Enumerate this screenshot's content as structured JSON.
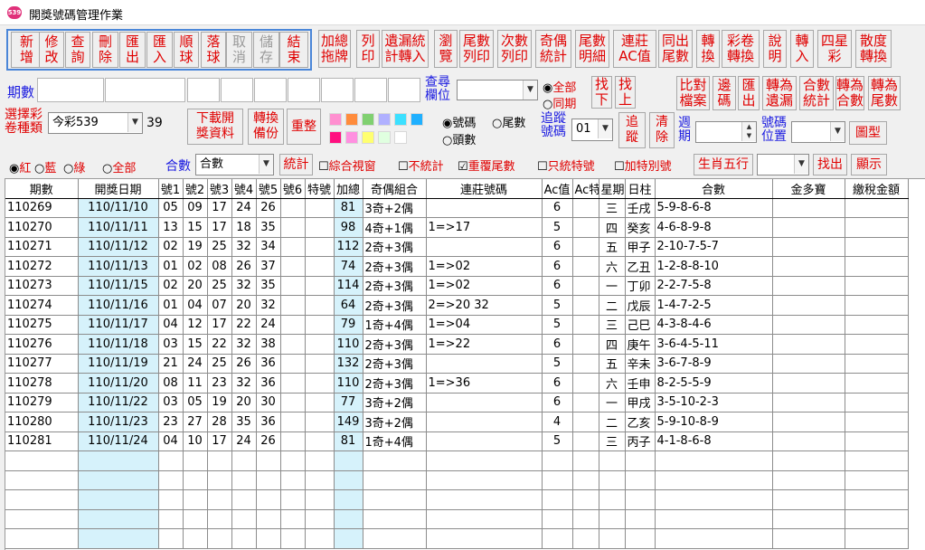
{
  "window": {
    "title": "開獎號碼管理作業",
    "icon_text": "539"
  },
  "toolbar1": [
    {
      "label": "新\n增",
      "disabled": false
    },
    {
      "label": "修\n改",
      "disabled": false
    },
    {
      "label": "查\n詢",
      "disabled": false
    },
    {
      "label": "刪\n除",
      "disabled": false
    },
    {
      "label": "匯\n出",
      "disabled": false
    },
    {
      "label": "匯\n入",
      "disabled": false
    },
    {
      "label": "順\n球",
      "disabled": false
    },
    {
      "label": "落\n球",
      "disabled": false
    },
    {
      "label": "取\n消",
      "disabled": true
    },
    {
      "label": "儲\n存",
      "disabled": true
    },
    {
      "label": "結\n束",
      "disabled": false
    }
  ],
  "toolbar2": [
    "加總\n拖牌",
    "列\n印",
    "遺漏統\n計轉入",
    "瀏\n覽",
    "尾數\n列印",
    "次數\n列印",
    "奇偶\n統計",
    "尾數\n明細",
    "連莊\nAC值",
    "同出\n尾數",
    "轉\n換",
    "彩卷\n轉換",
    "說\n明",
    "轉\n入",
    "四星\n彩",
    "散度\n轉換"
  ],
  "row2": {
    "period_label": "期數",
    "query_label": "查尋\n欄位",
    "radio_all": "全部",
    "radio_same": "同期",
    "btn_find_down": "找\n下",
    "btn_find_up": "找\n上",
    "right_buttons": [
      "比對\n檔案",
      "邊\n碼",
      "匯\n出",
      "轉為\n遺漏",
      "合數\n統計",
      "轉為\n合數",
      "轉為\n尾數"
    ]
  },
  "row3": {
    "lottery_type_label": "選擇彩\n卷種類",
    "lottery_type_value": "今彩539",
    "lottery_count": "39",
    "btn_download": "下載開\n獎資料",
    "btn_backup": "轉換\n備份",
    "btn_reorg": "重整",
    "swatch_colors": [
      "#ff8fd0",
      "#ff8c3c",
      "#80d070",
      "#b0b0ff",
      "#3ce0ff",
      "#20b0ff",
      "#ff1080",
      "#ff90e0",
      "#ffff70",
      "#e0ffe0",
      "#ffffff"
    ],
    "radio_number": "號碼",
    "radio_tail": "尾數",
    "radio_head": "頭數",
    "track_label": "追蹤\n號碼",
    "track_value": "01",
    "btn_track": "追\n蹤",
    "btn_clear": "清\n除",
    "week_label": "週\n期",
    "pos_label": "號碼\n位置",
    "btn_chart": "圖型"
  },
  "row4": {
    "radio_red": "紅",
    "radio_blue": "藍",
    "radio_green": "綠",
    "radio_all": "全部",
    "sum_label": "合數",
    "sum_value": "合數",
    "btn_stat": "統計",
    "chk_combined": "綜合視窗",
    "chk_nostat": "不統計",
    "chk_repeat": "重覆尾數",
    "chk_only_special": "只統特號",
    "chk_add_special": "加特別號",
    "btn_zodiac": "生肖五行",
    "btn_find": "找出",
    "btn_show": "顯示"
  },
  "grid": {
    "columns": [
      "期數",
      "開獎日期",
      "號1",
      "號2",
      "號3",
      "號4",
      "號5",
      "號6",
      "特號",
      "加總",
      "奇偶組合",
      "連莊號碼",
      "Ac值",
      "Ac特",
      "星期",
      "日柱",
      "合數",
      "金多寶",
      "繳稅金額"
    ],
    "rows": [
      [
        "110269",
        "110/11/10",
        "05",
        "09",
        "17",
        "24",
        "26",
        "",
        "",
        "81",
        "3奇+2偶",
        "",
        "6",
        "",
        "三",
        "壬戌",
        "5-9-8-6-8",
        "",
        ""
      ],
      [
        "110270",
        "110/11/11",
        "13",
        "15",
        "17",
        "18",
        "35",
        "",
        "",
        "98",
        "4奇+1偶",
        "1=>17",
        "5",
        "",
        "四",
        "癸亥",
        "4-6-8-9-8",
        "",
        ""
      ],
      [
        "110271",
        "110/11/12",
        "02",
        "19",
        "25",
        "32",
        "34",
        "",
        "",
        "112",
        "2奇+3偶",
        "",
        "6",
        "",
        "五",
        "甲子",
        "2-10-7-5-7",
        "",
        ""
      ],
      [
        "110272",
        "110/11/13",
        "01",
        "02",
        "08",
        "26",
        "37",
        "",
        "",
        "74",
        "2奇+3偶",
        "1=>02",
        "6",
        "",
        "六",
        "乙丑",
        "1-2-8-8-10",
        "",
        ""
      ],
      [
        "110273",
        "110/11/15",
        "02",
        "20",
        "25",
        "32",
        "35",
        "",
        "",
        "114",
        "2奇+3偶",
        "1=>02",
        "6",
        "",
        "一",
        "丁卯",
        "2-2-7-5-8",
        "",
        ""
      ],
      [
        "110274",
        "110/11/16",
        "01",
        "04",
        "07",
        "20",
        "32",
        "",
        "",
        "64",
        "2奇+3偶",
        "2=>20 32",
        "5",
        "",
        "二",
        "戊辰",
        "1-4-7-2-5",
        "",
        ""
      ],
      [
        "110275",
        "110/11/17",
        "04",
        "12",
        "17",
        "22",
        "24",
        "",
        "",
        "79",
        "1奇+4偶",
        "1=>04",
        "5",
        "",
        "三",
        "己巳",
        "4-3-8-4-6",
        "",
        ""
      ],
      [
        "110276",
        "110/11/18",
        "03",
        "15",
        "22",
        "32",
        "38",
        "",
        "",
        "110",
        "2奇+3偶",
        "1=>22",
        "6",
        "",
        "四",
        "庚午",
        "3-6-4-5-11",
        "",
        ""
      ],
      [
        "110277",
        "110/11/19",
        "21",
        "24",
        "25",
        "26",
        "36",
        "",
        "",
        "132",
        "2奇+3偶",
        "",
        "5",
        "",
        "五",
        "辛未",
        "3-6-7-8-9",
        "",
        ""
      ],
      [
        "110278",
        "110/11/20",
        "08",
        "11",
        "23",
        "32",
        "36",
        "",
        "",
        "110",
        "2奇+3偶",
        "1=>36",
        "6",
        "",
        "六",
        "壬申",
        "8-2-5-5-9",
        "",
        ""
      ],
      [
        "110279",
        "110/11/22",
        "03",
        "05",
        "19",
        "20",
        "30",
        "",
        "",
        "77",
        "3奇+2偶",
        "",
        "6",
        "",
        "一",
        "甲戌",
        "3-5-10-2-3",
        "",
        ""
      ],
      [
        "110280",
        "110/11/23",
        "23",
        "27",
        "28",
        "35",
        "36",
        "",
        "",
        "149",
        "3奇+2偶",
        "",
        "4",
        "",
        "二",
        "乙亥",
        "5-9-10-8-9",
        "",
        ""
      ],
      [
        "110281",
        "110/11/24",
        "04",
        "10",
        "17",
        "24",
        "26",
        "",
        "",
        "81",
        "1奇+4偶",
        "",
        "5",
        "",
        "三",
        "丙子",
        "4-1-8-6-8",
        "",
        ""
      ]
    ],
    "empty_rows": 5
  }
}
